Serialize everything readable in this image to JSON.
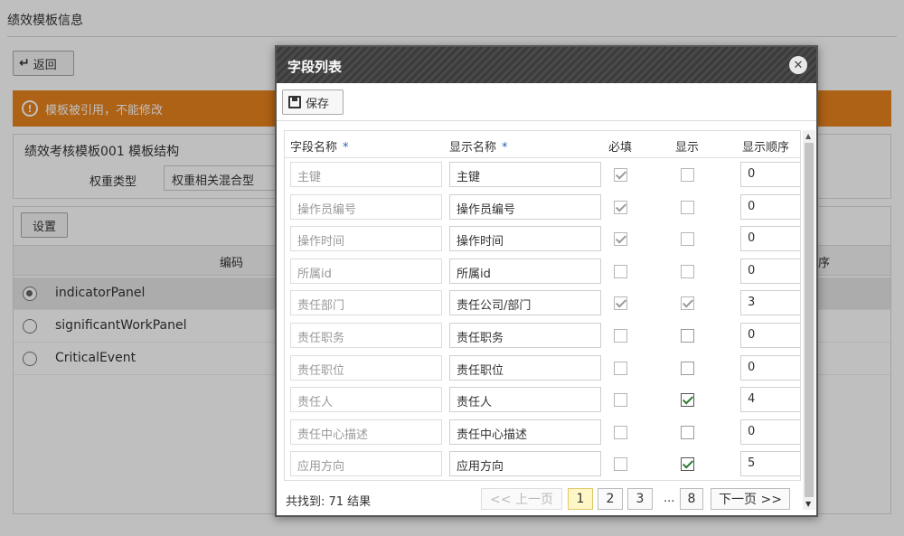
{
  "page": {
    "title": "绩效模板信息",
    "back_label": "返回",
    "warning": "模板被引用，不能修改",
    "section_title": "绩效考核模板001 模板结构",
    "weight_type_label": "权重类型",
    "weight_type_value": "权重相关混合型",
    "set_button": "设置",
    "grid_code_header": "编码",
    "grid_right_header_partial": "序",
    "rows": [
      {
        "code": "indicatorPanel",
        "selected": true
      },
      {
        "code": "significantWorkPanel",
        "selected": false
      },
      {
        "code": "CriticalEvent",
        "selected": false
      }
    ]
  },
  "modal": {
    "title": "字段列表",
    "close_glyph": "✕",
    "save_label": "保存",
    "headers": {
      "field_name": "字段名称",
      "display_name": "显示名称",
      "required": "必填",
      "show": "显示",
      "order": "显示顺序",
      "required_marker": "*"
    },
    "rows": [
      {
        "field": "主键",
        "display": "主键",
        "required": true,
        "shown": false,
        "order": "0"
      },
      {
        "field": "操作员编号",
        "display": "操作员编号",
        "required": true,
        "shown": false,
        "order": "0"
      },
      {
        "field": "操作时间",
        "display": "操作时间",
        "required": true,
        "shown": false,
        "order": "0"
      },
      {
        "field": "所属id",
        "display": "所属id",
        "required": false,
        "shown": false,
        "order": "0"
      },
      {
        "field": "责任部门",
        "display": "责任公司/部门",
        "required": true,
        "shown": true,
        "order": "3"
      },
      {
        "field": "责任职务",
        "display": "责任职务",
        "required": false,
        "shown": false,
        "order": "0"
      },
      {
        "field": "责任职位",
        "display": "责任职位",
        "required": false,
        "shown": false,
        "order": "0"
      },
      {
        "field": "责任人",
        "display": "责任人",
        "required": false,
        "shown": true,
        "order": "4"
      },
      {
        "field": "责任中心描述",
        "display": "责任中心描述",
        "required": false,
        "shown": false,
        "order": "0"
      },
      {
        "field": "应用方向",
        "display": "应用方向",
        "required": false,
        "shown": true,
        "order": "5"
      }
    ],
    "footer": {
      "total": "共找到: 71 结果",
      "prev": "<< 上一页",
      "pages": [
        "1",
        "2",
        "3"
      ],
      "ellipsis": "...",
      "last_page": "8",
      "next": "下一页 >>",
      "current_page": "1"
    }
  },
  "colors": {
    "warning": "#e9831c",
    "check_enabled": "#2d7a2d",
    "current_page": "#fff6c8"
  }
}
